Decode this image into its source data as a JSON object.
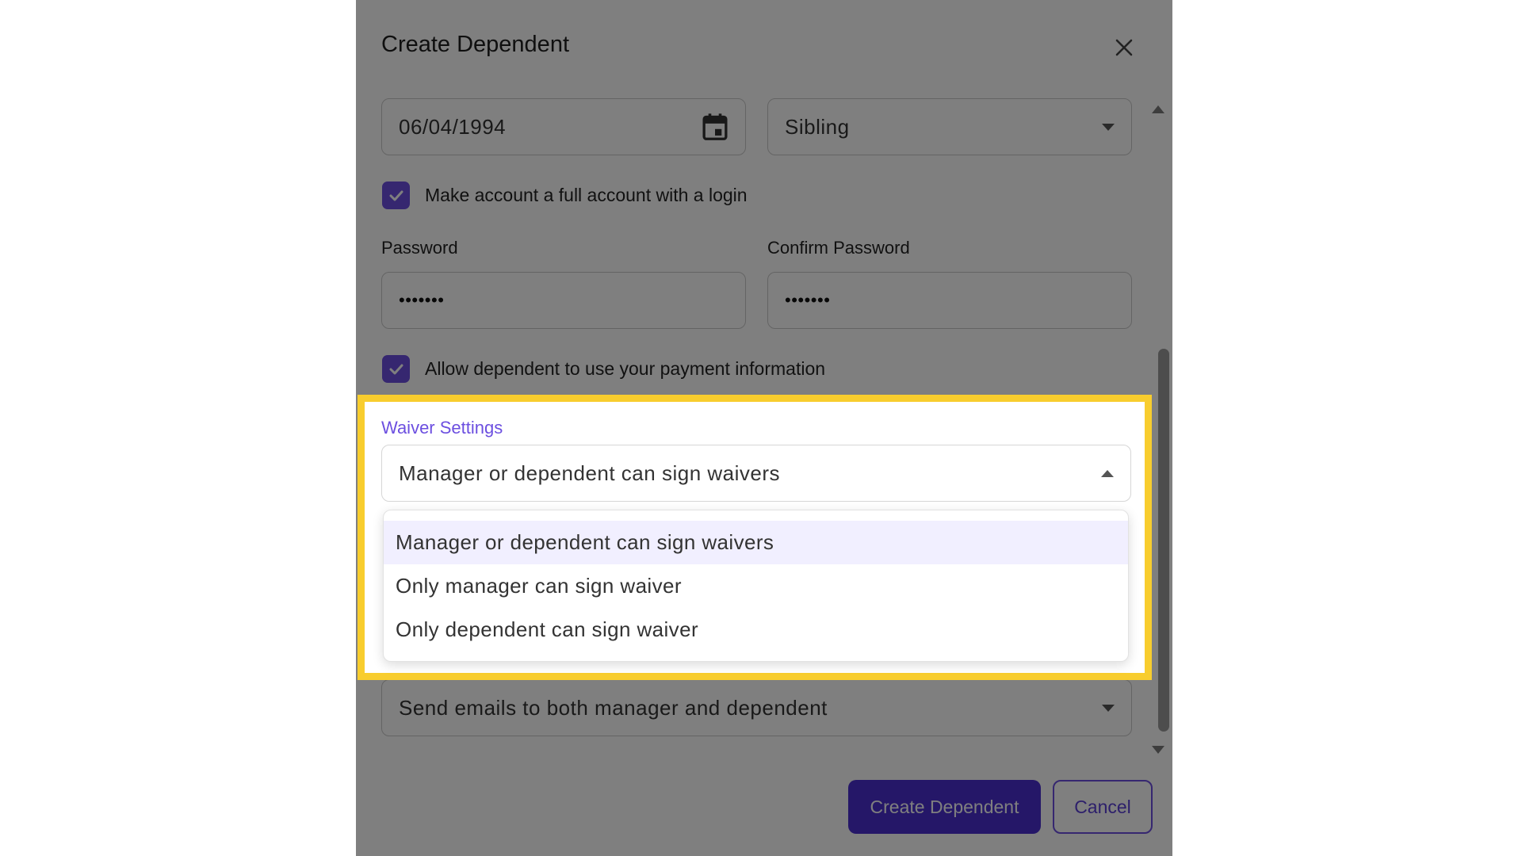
{
  "modal": {
    "title": "Create Dependent",
    "close_icon": "close-icon"
  },
  "form": {
    "birthdate_value": "06/04/1994",
    "calendar_icon": "calendar-icon",
    "relationship_value": "Sibling",
    "full_account_checkbox_label": "Make account a full account with a login",
    "full_account_checked": true,
    "password_label": "Password",
    "password_value": "•••••••",
    "confirm_password_label": "Confirm Password",
    "confirm_password_value": "•••••••",
    "payment_checkbox_label": "Allow dependent to use your payment information",
    "payment_checked": true,
    "waiver_section_label": "Waiver Settings",
    "waiver_selected_value": "Manager or dependent can sign waivers",
    "waiver_options": [
      "Manager or dependent can sign waivers",
      "Only manager can sign waiver",
      "Only dependent can sign waiver"
    ],
    "email_selected_value": "Send emails to both manager and dependent"
  },
  "actions": {
    "create_label": "Create Dependent",
    "cancel_label": "Cancel"
  },
  "colors": {
    "accent": "#6c4fe0",
    "primary_button": "#4a2ed1",
    "highlight_border": "#f8cd2e",
    "overlay": "rgba(0,0,0,0.5)"
  }
}
